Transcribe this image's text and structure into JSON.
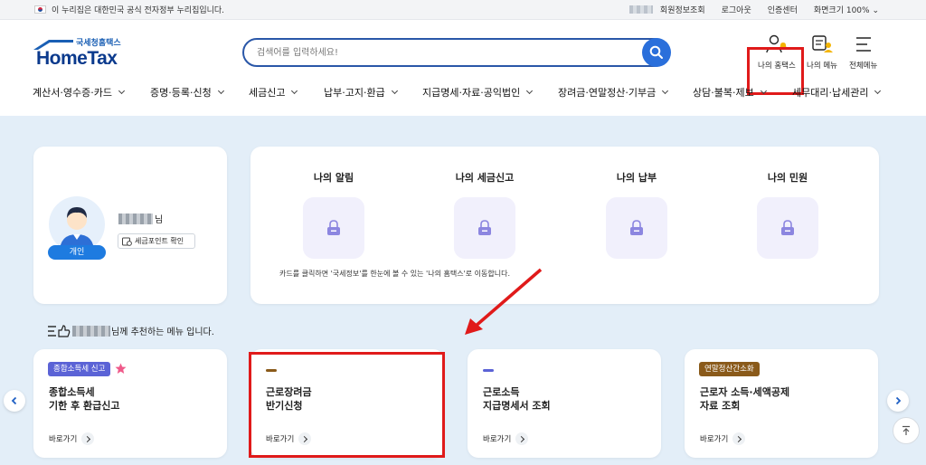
{
  "govbar": {
    "notice": "이 누리집은 대한민국 공식 전자정부 누리집입니다.",
    "links": [
      "회원정보조회",
      "로그아웃",
      "인증센터"
    ],
    "screen_size": "화면크기 100%"
  },
  "logo": {
    "small": "국세청홈택스",
    "big": "HomeTax"
  },
  "search": {
    "placeholder": "검색어를 입력하세요!"
  },
  "header_icons": {
    "my_hometax": "나의 홈택스",
    "my_menu": "나의 메뉴",
    "all_menu": "전체메뉴"
  },
  "nav": [
    "계산서·영수증·카드",
    "증명·등록·신청",
    "세금신고",
    "납부·고지·환급",
    "지급명세·자료·공익법인",
    "장려금·연말정산·기부금",
    "상담·불복·제보",
    "세무대리·납세관리"
  ],
  "profile": {
    "suffix": "님",
    "badge": "개인",
    "taxpoint": "세금포인트 확인"
  },
  "my": {
    "cols": [
      "나의 알림",
      "나의 세금신고",
      "나의 납부",
      "나의 민원"
    ],
    "note": "카드를 클릭하면 '국세정보'를 한눈에 볼 수 있는 '나의 홈택스'로 이동합니다."
  },
  "recommend": {
    "label": "님께 추천하는 메뉴 입니다.",
    "cards": [
      {
        "tag": "종합소득세 신고",
        "title": "종합소득세\n기한 후 환급신고",
        "go": "바로가기"
      },
      {
        "title": "근로장려금\n반기신청",
        "go": "바로가기"
      },
      {
        "title": "근로소득\n지급명세서 조회",
        "go": "바로가기"
      },
      {
        "tag": "연말정산간소화",
        "title": "근로자 소득·세액공제\n자료 조회",
        "go": "바로가기"
      }
    ]
  },
  "colors": {
    "brand": "#0b3a8d",
    "accent": "#2a6fdb",
    "highlight_red": "#e01a1a",
    "tag_purple": "#5b63d6",
    "tag_brown": "#8a5a1a"
  }
}
